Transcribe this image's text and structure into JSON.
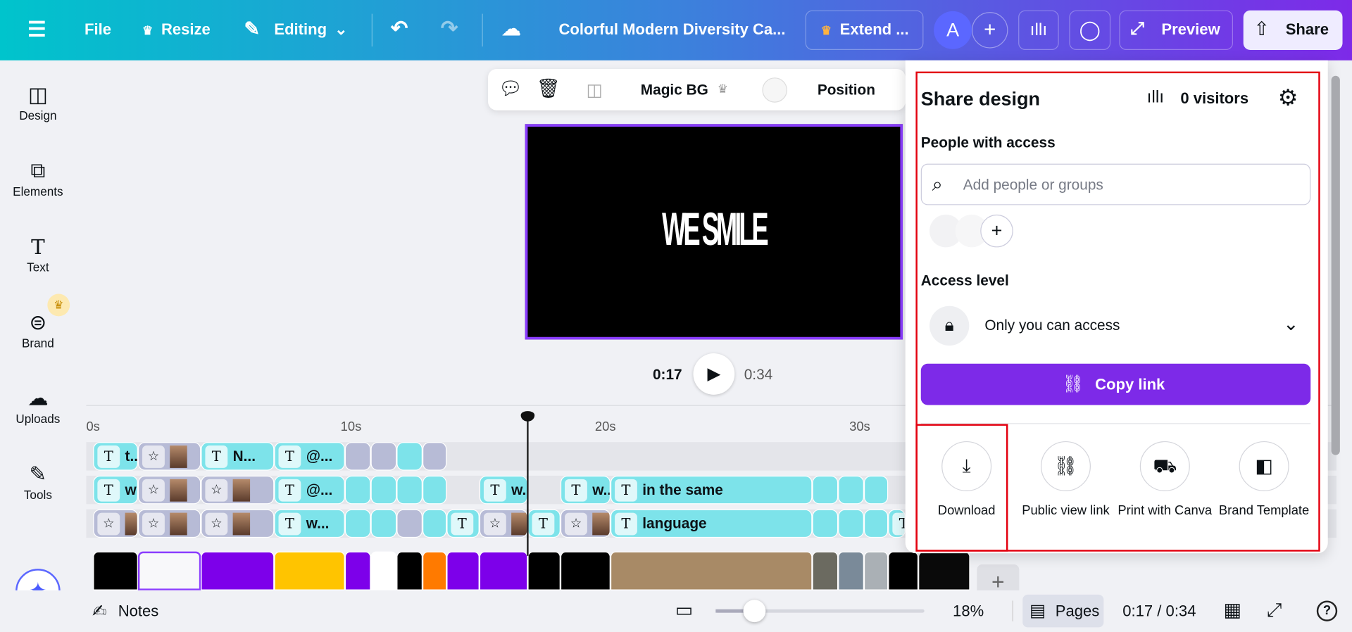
{
  "topbar": {
    "file": "File",
    "resize": "Resize",
    "editing": "Editing",
    "title": "Colorful Modern Diversity Ca...",
    "extend": "Extend ...",
    "avatar": "A",
    "preview": "Preview",
    "share": "Share"
  },
  "sidebar": {
    "items": [
      {
        "label": "Design",
        "icon": "design-icon"
      },
      {
        "label": "Elements",
        "icon": "elements-icon"
      },
      {
        "label": "Text",
        "icon": "text-icon"
      },
      {
        "label": "Brand",
        "icon": "brand-icon"
      },
      {
        "label": "Uploads",
        "icon": "uploads-icon"
      },
      {
        "label": "Tools",
        "icon": "tools-icon"
      }
    ]
  },
  "toolbar": {
    "magic_bg": "Magic BG",
    "position": "Position"
  },
  "canvas": {
    "text": "WE SMILE"
  },
  "playback": {
    "current": "0:17",
    "total": "0:34"
  },
  "timeline": {
    "ticks": [
      "0s",
      "10s",
      "20s",
      "30s"
    ],
    "rows": [
      [
        [
          "T",
          "t.."
        ],
        [
          "S",
          ""
        ],
        [
          "T",
          "N..."
        ],
        [
          "T",
          "@..."
        ],
        [
          "g",
          ""
        ],
        [
          "g",
          ""
        ],
        [
          "c",
          ""
        ],
        [
          "g",
          ""
        ]
      ],
      [
        [
          "T",
          "w"
        ],
        [
          "S",
          ""
        ],
        [
          "S",
          ""
        ],
        [
          "T",
          "@..."
        ],
        [
          "c",
          ""
        ],
        [
          "c",
          ""
        ],
        [
          "c",
          ""
        ],
        [
          "c",
          ""
        ],
        [
          "T",
          "w."
        ],
        [
          "T",
          "w.."
        ],
        [
          "T",
          "in the same"
        ],
        [
          "c",
          ""
        ],
        [
          "c",
          ""
        ],
        [
          "c",
          ""
        ]
      ],
      [
        [
          "S",
          ""
        ],
        [
          "S",
          ""
        ],
        [
          "S",
          ""
        ],
        [
          "T",
          "w..."
        ],
        [
          "c",
          ""
        ],
        [
          "c",
          ""
        ],
        [
          "g",
          ""
        ],
        [
          "c",
          ""
        ],
        [
          "T",
          ""
        ],
        [
          "S",
          ""
        ],
        [
          "T",
          ""
        ],
        [
          "S",
          ""
        ],
        [
          "T",
          "language"
        ],
        [
          "c",
          ""
        ],
        [
          "c",
          ""
        ],
        [
          "c",
          ""
        ],
        [
          "T",
          ""
        ]
      ]
    ],
    "thumb_colors": [
      "#000000",
      "#f8f8fa",
      "#7d00ea",
      "#ffc400",
      "#7d00ea",
      "#ffffff",
      "#000000",
      "#ff7a00",
      "#7d00ea",
      "#7d00ea",
      "#000000",
      "#000000",
      "#a88a66",
      "#6b6a60",
      "#7a8a99",
      "#aab0b5",
      "#000000",
      "#0a0a0a"
    ]
  },
  "bottombar": {
    "notes": "Notes",
    "zoom": "18%",
    "zoom_level": 18,
    "pages": "Pages",
    "time": "0:17 / 0:34"
  },
  "share_panel": {
    "title": "Share design",
    "visitors": "0 visitors",
    "people_label": "People with access",
    "search_placeholder": "Add people or groups",
    "access_label": "Access level",
    "access_value": "Only you can access",
    "copy_link": "Copy link",
    "options": [
      {
        "label": "Download",
        "icon": "download-icon"
      },
      {
        "label": "Public view link",
        "icon": "link-icon"
      },
      {
        "label": "Print with Canva",
        "icon": "truck-icon"
      },
      {
        "label": "Brand Template",
        "icon": "template-icon"
      }
    ]
  },
  "colors": {
    "accent": "#7d2ae8",
    "highlight": "#e3000f",
    "selection": "#8b3dff"
  }
}
